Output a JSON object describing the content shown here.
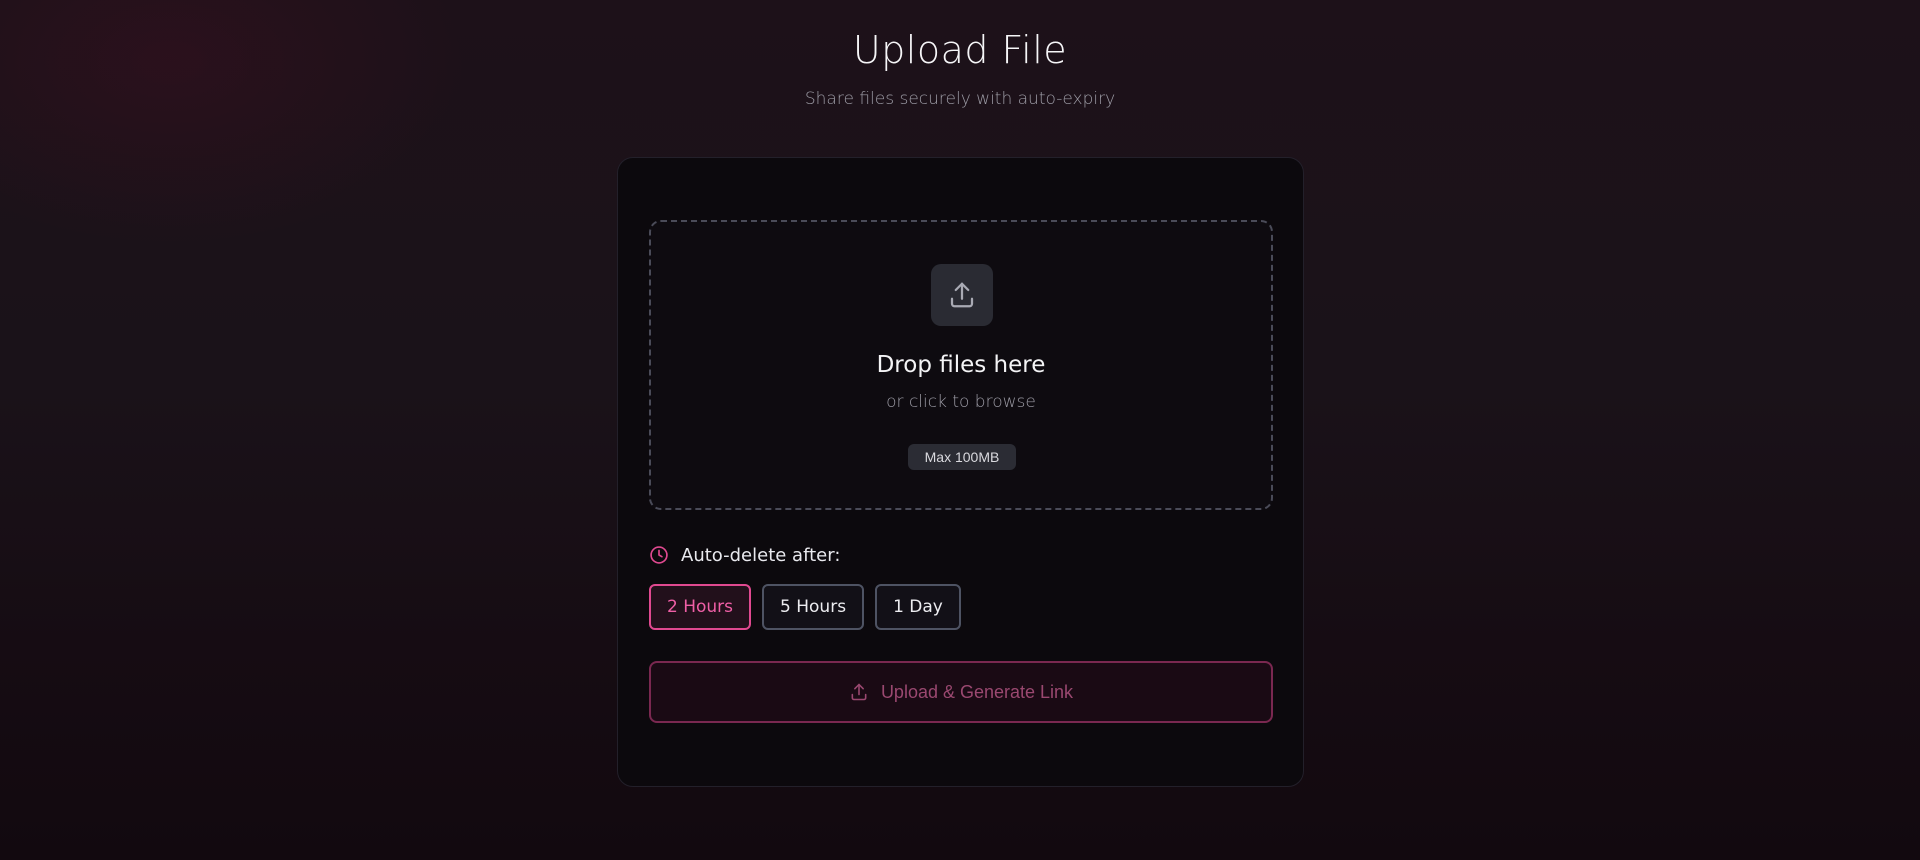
{
  "header": {
    "title": "Upload File",
    "subtitle": "Share files securely with auto-expiry"
  },
  "dropzone": {
    "icon": "upload-icon",
    "title": "Drop files here",
    "hint": "or click to browse",
    "size_badge": "Max 100MB"
  },
  "expiry": {
    "icon": "clock-icon",
    "label": "Auto-delete after:",
    "options": [
      {
        "label": "2 Hours",
        "selected": true
      },
      {
        "label": "5 Hours",
        "selected": false
      },
      {
        "label": "1 Day",
        "selected": false
      }
    ]
  },
  "upload_button": {
    "icon": "upload-icon",
    "label": "Upload & Generate Link"
  },
  "colors": {
    "accent": "#e04990",
    "accent_text": "#ef5fa6",
    "background": "#1a1219",
    "card": "#0c090d"
  }
}
